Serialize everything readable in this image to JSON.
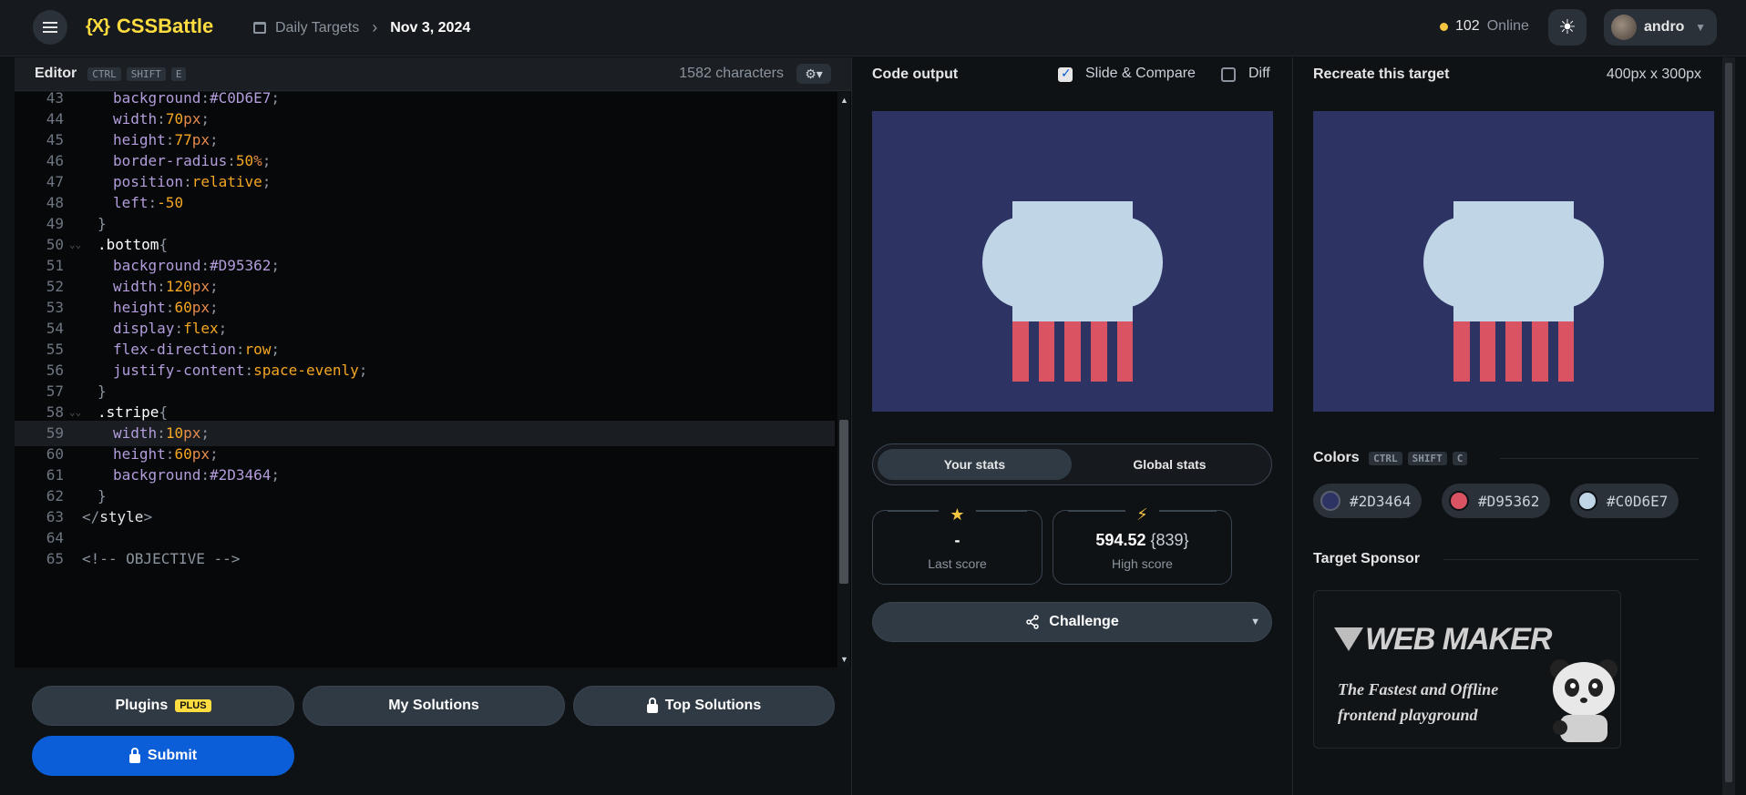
{
  "header": {
    "app_name": "CSSBattle",
    "logo_mark": "{X}",
    "breadcrumb_section": "Daily Targets",
    "breadcrumb_date": "Nov 3, 2024",
    "online_count": "102",
    "online_label": "Online",
    "username": "andro"
  },
  "editor": {
    "title": "Editor",
    "shortcut": [
      "CTRL",
      "SHIFT",
      "E"
    ],
    "char_count": "1582 characters",
    "lines": [
      {
        "n": "43",
        "tokens": [
          [
            "prop",
            "background"
          ],
          [
            "punc",
            ":"
          ],
          [
            "hex",
            "#C0D6E7"
          ],
          [
            "punc",
            ";"
          ]
        ],
        "indent": 2
      },
      {
        "n": "44",
        "tokens": [
          [
            "prop",
            "width"
          ],
          [
            "punc",
            ":"
          ],
          [
            "val",
            "70"
          ],
          [
            "unit",
            "px"
          ],
          [
            "punc",
            ";"
          ]
        ],
        "indent": 2
      },
      {
        "n": "45",
        "tokens": [
          [
            "prop",
            "height"
          ],
          [
            "punc",
            ":"
          ],
          [
            "val",
            "77"
          ],
          [
            "unit",
            "px"
          ],
          [
            "punc",
            ";"
          ]
        ],
        "indent": 2
      },
      {
        "n": "46",
        "tokens": [
          [
            "prop",
            "border-radius"
          ],
          [
            "punc",
            ":"
          ],
          [
            "val",
            "50"
          ],
          [
            "unit",
            "%"
          ],
          [
            "punc",
            ";"
          ]
        ],
        "indent": 2
      },
      {
        "n": "47",
        "tokens": [
          [
            "prop",
            "position"
          ],
          [
            "punc",
            ":"
          ],
          [
            "val",
            "relative"
          ],
          [
            "punc",
            ";"
          ]
        ],
        "indent": 2
      },
      {
        "n": "48",
        "tokens": [
          [
            "prop",
            "left"
          ],
          [
            "punc",
            ":"
          ],
          [
            "val",
            "-50"
          ]
        ],
        "indent": 2
      },
      {
        "n": "49",
        "tokens": [
          [
            "punc",
            "}"
          ]
        ],
        "indent": 1
      },
      {
        "n": "50",
        "tokens": [
          [
            "sel",
            ".bottom"
          ],
          [
            "punc",
            "{"
          ]
        ],
        "indent": 1,
        "fold": true
      },
      {
        "n": "51",
        "tokens": [
          [
            "prop",
            "background"
          ],
          [
            "punc",
            ":"
          ],
          [
            "hex",
            "#D95362"
          ],
          [
            "punc",
            ";"
          ]
        ],
        "indent": 2
      },
      {
        "n": "52",
        "tokens": [
          [
            "prop",
            "width"
          ],
          [
            "punc",
            ":"
          ],
          [
            "val",
            "120"
          ],
          [
            "unit",
            "px"
          ],
          [
            "punc",
            ";"
          ]
        ],
        "indent": 2
      },
      {
        "n": "53",
        "tokens": [
          [
            "prop",
            "height"
          ],
          [
            "punc",
            ":"
          ],
          [
            "val",
            "60"
          ],
          [
            "unit",
            "px"
          ],
          [
            "punc",
            ";"
          ]
        ],
        "indent": 2
      },
      {
        "n": "54",
        "tokens": [
          [
            "prop",
            "display"
          ],
          [
            "punc",
            ":"
          ],
          [
            "val",
            "flex"
          ],
          [
            "punc",
            ";"
          ]
        ],
        "indent": 2
      },
      {
        "n": "55",
        "tokens": [
          [
            "prop",
            "flex-direction"
          ],
          [
            "punc",
            ":"
          ],
          [
            "val",
            "row"
          ],
          [
            "punc",
            ";"
          ]
        ],
        "indent": 2
      },
      {
        "n": "56",
        "tokens": [
          [
            "prop",
            "justify-content"
          ],
          [
            "punc",
            ":"
          ],
          [
            "val",
            "space-evenly"
          ],
          [
            "punc",
            ";"
          ]
        ],
        "indent": 2
      },
      {
        "n": "57",
        "tokens": [
          [
            "punc",
            "}"
          ]
        ],
        "indent": 1
      },
      {
        "n": "58",
        "tokens": [
          [
            "sel",
            ".stripe"
          ],
          [
            "punc",
            "{"
          ]
        ],
        "indent": 1,
        "fold": true
      },
      {
        "n": "59",
        "tokens": [
          [
            "prop",
            "width"
          ],
          [
            "punc",
            ":"
          ],
          [
            "val",
            "10"
          ],
          [
            "unit",
            "px"
          ],
          [
            "punc",
            ";"
          ]
        ],
        "indent": 2,
        "active": true
      },
      {
        "n": "60",
        "tokens": [
          [
            "prop",
            "height"
          ],
          [
            "punc",
            ":"
          ],
          [
            "val",
            "60"
          ],
          [
            "unit",
            "px"
          ],
          [
            "punc",
            ";"
          ]
        ],
        "indent": 2
      },
      {
        "n": "61",
        "tokens": [
          [
            "prop",
            "background"
          ],
          [
            "punc",
            ":"
          ],
          [
            "hex",
            "#2D3464"
          ],
          [
            "punc",
            ";"
          ]
        ],
        "indent": 2
      },
      {
        "n": "62",
        "tokens": [
          [
            "punc",
            "}"
          ]
        ],
        "indent": 1
      },
      {
        "n": "63",
        "tokens": [
          [
            "punc",
            "</"
          ],
          [
            "tag",
            "style"
          ],
          [
            "punc",
            ">"
          ]
        ],
        "indent": 0
      },
      {
        "n": "64",
        "tokens": [],
        "indent": 0
      },
      {
        "n": "65",
        "tokens": [
          [
            "cmt",
            "<!-- OBJECTIVE -->"
          ]
        ],
        "indent": 0
      }
    ]
  },
  "actions": {
    "plugins": "Plugins",
    "plugins_badge": "PLUS",
    "my_solutions": "My Solutions",
    "top_solutions": "Top Solutions",
    "submit": "Submit"
  },
  "output": {
    "title": "Code output",
    "slide_compare": "Slide & Compare",
    "slide_compare_checked": true,
    "diff": "Diff",
    "diff_checked": false
  },
  "stats": {
    "your_stats": "Your stats",
    "global_stats": "Global stats",
    "last_score": "-",
    "last_score_label": "Last score",
    "high_score": "594.52",
    "high_score_chars": "{839}",
    "high_score_label": "High score",
    "challenge": "Challenge"
  },
  "target": {
    "title": "Recreate this target",
    "dimensions": "400px x 300px",
    "colors_title": "Colors",
    "colors_shortcut": [
      "CTRL",
      "SHIFT",
      "C"
    ],
    "colors": [
      "#2D3464",
      "#D95362",
      "#C0D6E7"
    ],
    "sponsor_title": "Target Sponsor",
    "sponsor_name": "WEB MAKER",
    "sponsor_tagline_1": "The Fastest and Offline",
    "sponsor_tagline_2": "frontend playground"
  }
}
